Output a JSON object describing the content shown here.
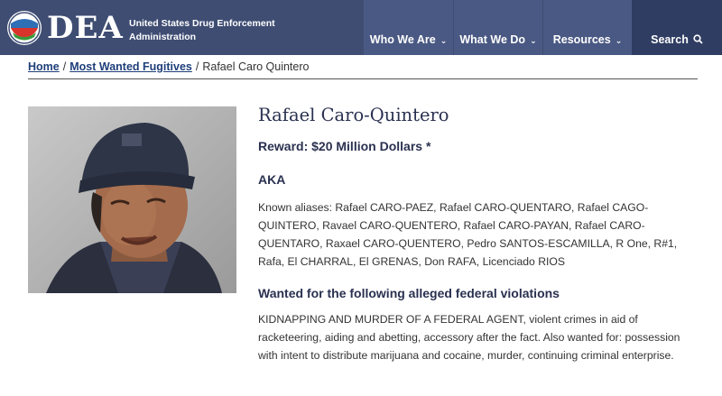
{
  "header": {
    "logo_text": "DEA",
    "agency_name": "United States Drug Enforcement Administration",
    "nav": [
      {
        "label": "Who We Are"
      },
      {
        "label": "What We Do"
      },
      {
        "label": "Resources"
      }
    ],
    "search_label": "Search",
    "colors": {
      "header_bg": "#3f4d73",
      "nav_bg": "#4a5983",
      "search_bg": "#2f3d63"
    }
  },
  "breadcrumb": {
    "home": "Home",
    "section": "Most Wanted Fugitives",
    "current": "Rafael Caro Quintero"
  },
  "fugitive": {
    "name": "Rafael Caro-Quintero",
    "reward": "Reward: $20 Million Dollars *",
    "aka_heading": "AKA",
    "aliases": "Known aliases: Rafael CARO-PAEZ, Rafael CARO-QUENTARO, Rafael CAGO-QUINTERO, Ravael CARO-QUENTERO, Rafael CARO-PAYAN, Rafael CARO-QUENTARO, Raxael CARO-QUENTERO, Pedro SANTOS-ESCAMILLA, R One, R#1, Rafa, El CHARRAL, El GRENAS, Don RAFA, Licenciado RIOS",
    "violations_heading": "Wanted for the following alleged federal violations",
    "violations": "KIDNAPPING AND MURDER OF A FEDERAL AGENT, violent crimes in aid of racketeering, aiding and abetting, accessory after the fact. Also wanted for: possession with intent to distribute marijuana and cocaine, murder, continuing criminal enterprise."
  }
}
